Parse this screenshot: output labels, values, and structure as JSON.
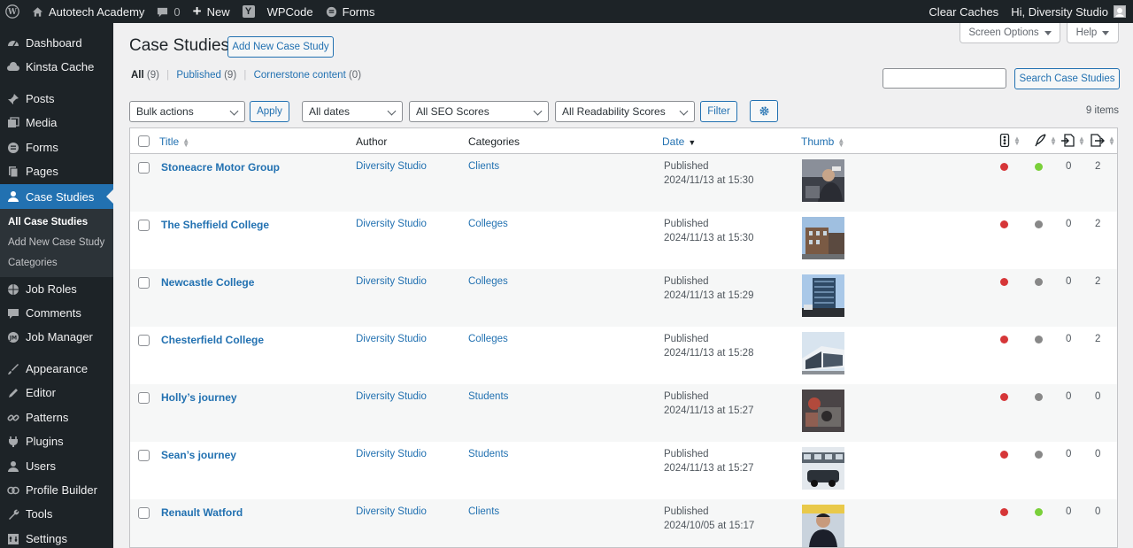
{
  "adminbar": {
    "site_name": "Autotech Academy",
    "comments_count": "0",
    "new_label": "New",
    "wpcode_label": "WPCode",
    "forms_label": "Forms",
    "clear_caches": "Clear Caches",
    "greeting": "Hi, Diversity Studio"
  },
  "sidebar": {
    "items": [
      {
        "label": "Dashboard",
        "icon": "dashboard-icon"
      },
      {
        "label": "Kinsta Cache",
        "icon": "cloud-icon"
      },
      {
        "label": "Posts",
        "icon": "pin-icon"
      },
      {
        "label": "Media",
        "icon": "media-icon"
      },
      {
        "label": "Forms",
        "icon": "forms-icon"
      },
      {
        "label": "Pages",
        "icon": "pages-icon"
      },
      {
        "label": "Case Studies",
        "icon": "person-icon",
        "active": true
      },
      {
        "label": "Job Roles",
        "icon": "globe-icon"
      },
      {
        "label": "Comments",
        "icon": "comment-icon"
      },
      {
        "label": "Job Manager",
        "icon": "jm-icon"
      },
      {
        "label": "Appearance",
        "icon": "brush-icon"
      },
      {
        "label": "Editor",
        "icon": "edit-icon"
      },
      {
        "label": "Patterns",
        "icon": "link-icon"
      },
      {
        "label": "Plugins",
        "icon": "plugin-icon"
      },
      {
        "label": "Users",
        "icon": "users-icon"
      },
      {
        "label": "Profile Builder",
        "icon": "rings-icon"
      },
      {
        "label": "Tools",
        "icon": "wrench-icon"
      },
      {
        "label": "Settings",
        "icon": "settings-icon"
      }
    ],
    "submenu": [
      "All Case Studies",
      "Add New Case Study",
      "Categories"
    ]
  },
  "page": {
    "title": "Case Studies",
    "add_new": "Add New Case Study",
    "screen_options": "Screen Options",
    "help": "Help",
    "views": {
      "all_label": "All",
      "all_count": "(9)",
      "published_label": "Published",
      "published_count": "(9)",
      "cornerstone_label": "Cornerstone content",
      "cornerstone_count": "(0)"
    },
    "search_button": "Search Case Studies",
    "search_value": "",
    "filters": {
      "bulk_actions": "Bulk actions",
      "apply": "Apply",
      "dates": "All dates",
      "seo": "All SEO Scores",
      "readability": "All Readability Scores",
      "filter": "Filter"
    },
    "items_count": "9 items"
  },
  "table": {
    "columns": {
      "title": "Title",
      "author": "Author",
      "categories": "Categories",
      "date": "Date",
      "thumb": "Thumb"
    },
    "rows": [
      {
        "title": "Stoneacre Motor Group",
        "author": "Diversity Studio",
        "category": "Clients",
        "status": "Published",
        "date": "2024/11/13 at 15:30",
        "seo": "#d63638",
        "read": "#7ad03a",
        "links_in": "0",
        "links_out": "2"
      },
      {
        "title": "The Sheffield College",
        "author": "Diversity Studio",
        "category": "Colleges",
        "status": "Published",
        "date": "2024/11/13 at 15:30",
        "seo": "#d63638",
        "read": "#888888",
        "links_in": "0",
        "links_out": "2"
      },
      {
        "title": "Newcastle College",
        "author": "Diversity Studio",
        "category": "Colleges",
        "status": "Published",
        "date": "2024/11/13 at 15:29",
        "seo": "#d63638",
        "read": "#888888",
        "links_in": "0",
        "links_out": "2"
      },
      {
        "title": "Chesterfield College",
        "author": "Diversity Studio",
        "category": "Colleges",
        "status": "Published",
        "date": "2024/11/13 at 15:28",
        "seo": "#d63638",
        "read": "#888888",
        "links_in": "0",
        "links_out": "2"
      },
      {
        "title": "Holly’s journey",
        "author": "Diversity Studio",
        "category": "Students",
        "status": "Published",
        "date": "2024/11/13 at 15:27",
        "seo": "#d63638",
        "read": "#888888",
        "links_in": "0",
        "links_out": "0"
      },
      {
        "title": "Sean’s journey",
        "author": "Diversity Studio",
        "category": "Students",
        "status": "Published",
        "date": "2024/11/13 at 15:27",
        "seo": "#d63638",
        "read": "#888888",
        "links_in": "0",
        "links_out": "0"
      },
      {
        "title": "Renault Watford",
        "author": "Diversity Studio",
        "category": "Clients",
        "status": "Published",
        "date": "2024/10/05 at 15:17",
        "seo": "#d63638",
        "read": "#7ad03a",
        "links_in": "0",
        "links_out": "0"
      }
    ]
  },
  "colors": {
    "accent": "#2271b1",
    "adminbar": "#1d2327",
    "active_menu": "#2271b1",
    "seo_bad": "#d63638",
    "good": "#7ad03a",
    "na": "#888888"
  }
}
